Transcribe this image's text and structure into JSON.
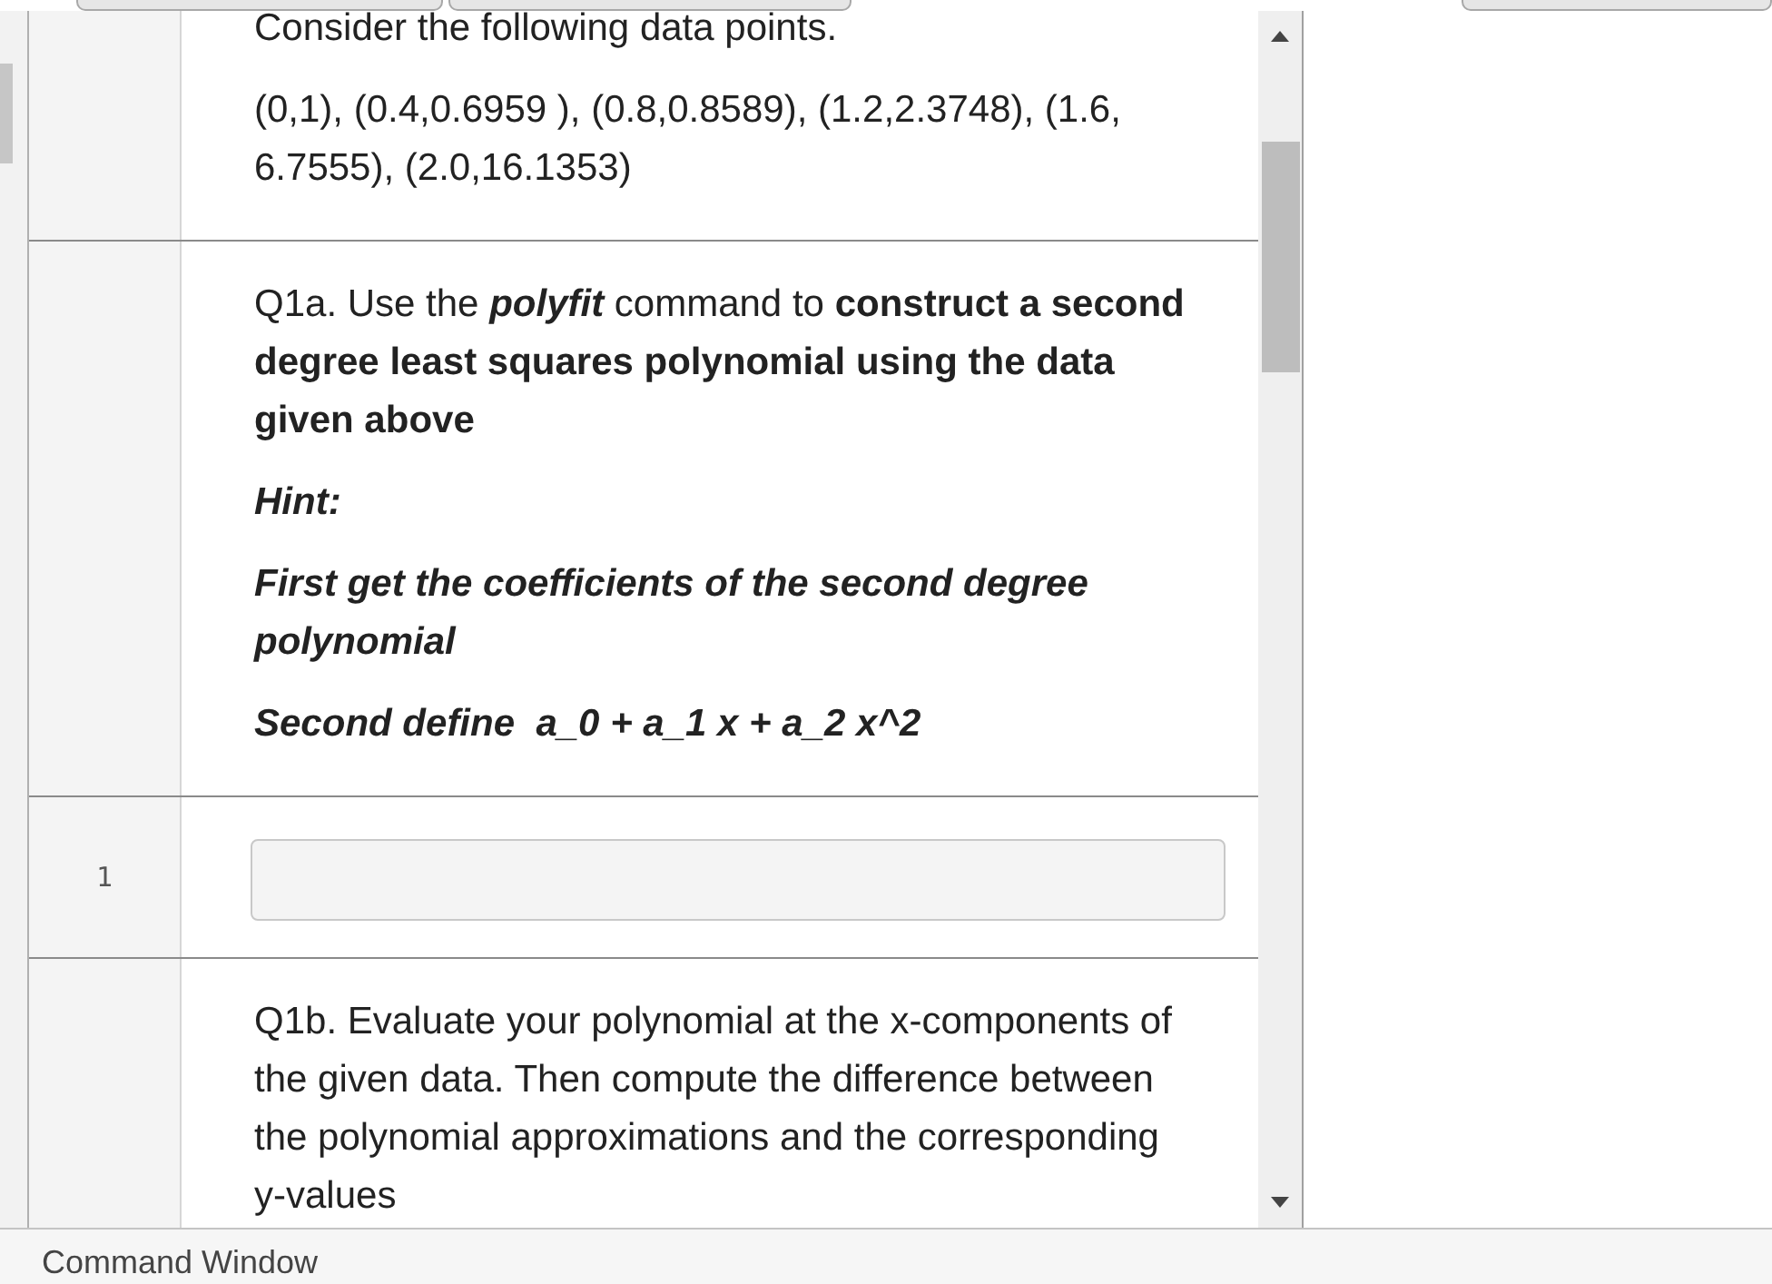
{
  "cells": [
    {
      "kind": "markdown",
      "paragraphs": [
        {
          "kind": "text",
          "text": "Consider the following data points."
        },
        {
          "kind": "text",
          "text": "(0,1), (0.4,0.6959 ), (0.8,0.8589), (1.2,2.3748), (1.6, 6.7555), (2.0,16.1353)"
        }
      ]
    },
    {
      "kind": "markdown",
      "paragraphs": [
        {
          "kind": "mixed",
          "segments": [
            {
              "kind": "plain",
              "text": "Q1a. Use the "
            },
            {
              "kind": "strong-emphasis",
              "text": "polyfit"
            },
            {
              "kind": "plain",
              "text": " command to "
            },
            {
              "kind": "strong",
              "text": "construct a second degree least squares polynomial using the data given above"
            }
          ]
        },
        {
          "kind": "hint",
          "text": "Hint:"
        },
        {
          "kind": "hint",
          "text": "First get the coefficients of the second degree polynomial"
        },
        {
          "kind": "hint",
          "text": "Second define  a_0 + a_1 x + a_2 x^2"
        }
      ]
    },
    {
      "kind": "code",
      "line_number": "1"
    },
    {
      "kind": "markdown",
      "paragraphs": [
        {
          "kind": "text",
          "text": "Q1b. Evaluate your polynomial at the x-components of the given data. Then compute the difference between the polynomial approximations and the corresponding y-values"
        }
      ]
    }
  ],
  "status_bar": {
    "title": "Command Window"
  }
}
